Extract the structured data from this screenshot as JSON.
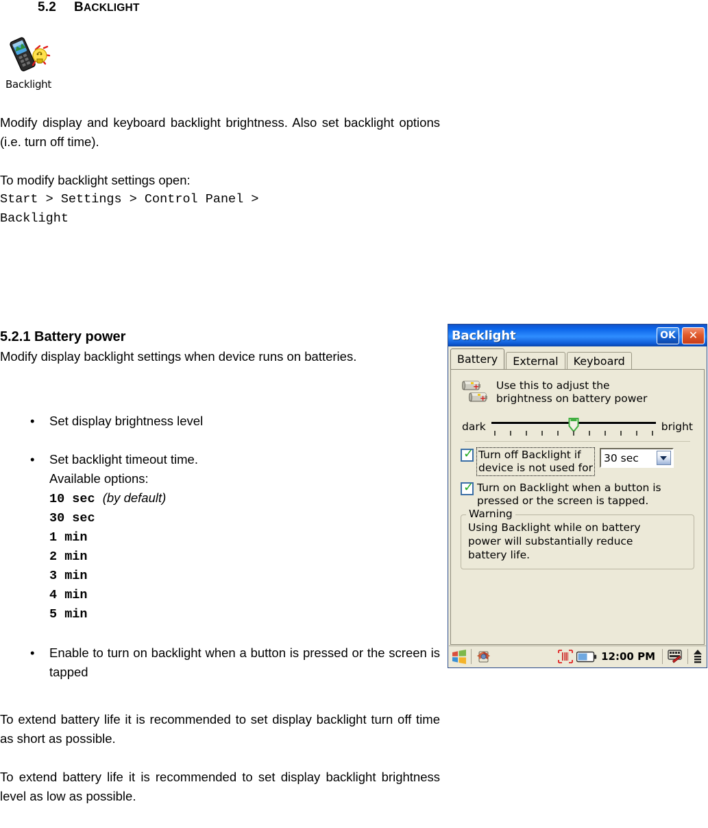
{
  "document": {
    "section_number": "5.2",
    "section_title_first": "B",
    "section_title_rest": "ACKLIGHT",
    "app_icon_label": "Backlight",
    "intro_paragraph": "Modify display and keyboard backlight brightness. Also set backlight options (i.e. turn off time).",
    "open_lead": "To modify backlight settings open:",
    "nav_path_line1": "Start > Settings > Control Panel >",
    "nav_path_line2": "Backlight",
    "subsection": {
      "heading": "5.2.1 Battery power",
      "intro": "Modify display backlight settings when device runs on batteries.",
      "bullets": [
        {
          "text": "Set display brightness level"
        },
        {
          "text": "Set backlight timeout time.",
          "sub_line": "Available options:",
          "options": [
            {
              "value": "10 sec",
              "note": "(by default)"
            },
            {
              "value": "30 sec",
              "note": ""
            },
            {
              "value": "1 min",
              "note": ""
            },
            {
              "value": "2 min",
              "note": ""
            },
            {
              "value": "3 min",
              "note": ""
            },
            {
              "value": "4 min",
              "note": ""
            },
            {
              "value": "5 min",
              "note": ""
            }
          ]
        },
        {
          "text": "Enable to turn on backlight when a button is pressed or the screen is tapped"
        }
      ],
      "tail_paragraph_1": "To extend battery life it is recommended to set display backlight turn off time as short as possible.",
      "tail_paragraph_2": "To extend battery life it is recommended to set display backlight brightness level as low as possible."
    }
  },
  "ce_dialog": {
    "title": "Backlight",
    "ok_label": "OK",
    "close_label": "✕",
    "tabs": [
      {
        "label": "Battery",
        "active": true
      },
      {
        "label": "External",
        "active": false
      },
      {
        "label": "Keyboard",
        "active": false
      }
    ],
    "info_text_line1": "Use this to adjust the",
    "info_text_line2": "brightness on battery power",
    "slider": {
      "left_label": "dark",
      "right_label": "bright",
      "tick_count": 11,
      "value_index": 6,
      "thumb_percent": 50
    },
    "checkbox_timeout": {
      "checked": true,
      "label_line1": "Turn off Backlight if",
      "label_line2": "device is not used for",
      "selected_value": "30 sec"
    },
    "checkbox_wake": {
      "checked": true,
      "label_line1": "Turn on Backlight when a button is",
      "label_line2": "pressed or the screen is tapped."
    },
    "warning": {
      "legend": "Warning",
      "line1": "Using Backlight while on battery",
      "line2": "power will substantially reduce",
      "line3": "battery life."
    },
    "taskbar": {
      "clock": "12:00 PM",
      "start_icon": "windows-flag-icon",
      "settings_icon": "control-panel-icon",
      "scanner_icon": "barcode-scanner-icon",
      "battery_icon": "battery-status-icon",
      "sip_icon": "soft-input-panel-icon",
      "arrow_icon": "up-arrow-icon"
    },
    "colors": {
      "title_bar": "#0a63e8",
      "ok_button": "#1565d8",
      "close_button": "#e05a2c",
      "window_face": "#ece9d8",
      "checkmark": "#22aa22",
      "slider_thumb": "#3fae3f"
    }
  }
}
